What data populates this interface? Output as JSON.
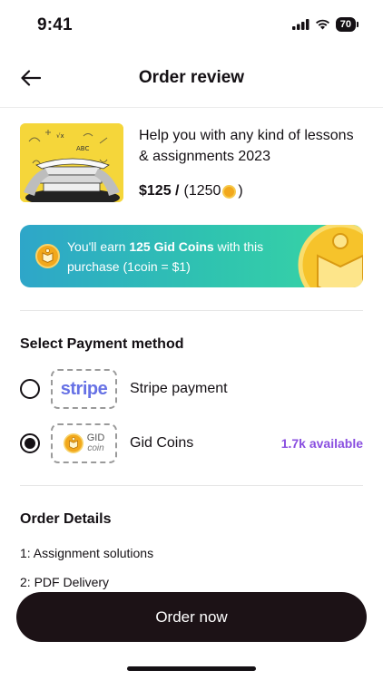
{
  "status_bar": {
    "time": "9:41",
    "battery": "70"
  },
  "header": {
    "title": "Order review",
    "back_icon": "arrow-left-icon"
  },
  "product": {
    "title": "Help you with any kind of lessons & assignments 2023",
    "price": "$125 /",
    "coin_price_open": "(1250",
    "coin_price_close": ")"
  },
  "earn_banner": {
    "prefix": "You'll earn ",
    "highlight": "125 Gid Coins",
    "suffix": " with this purchase (1coin = $1)"
  },
  "payment": {
    "section_title": "Select Payment method",
    "methods": [
      {
        "logo_text": "stripe",
        "label": "Stripe payment",
        "selected": false,
        "available": ""
      },
      {
        "logo_text_1": "GID",
        "logo_text_2": "coin",
        "label": "Gid Coins",
        "selected": true,
        "available": "1.7k available"
      }
    ]
  },
  "order_details": {
    "section_title": "Order Details",
    "lines": [
      "1: Assignment solutions",
      "2: PDF Delivery"
    ]
  },
  "cta": {
    "label": "Order now"
  },
  "colors": {
    "accent_purple": "#8a4fe0",
    "stripe_blue": "#6772e5",
    "button_dark": "#1c1216",
    "banner_start": "#2ea6c9",
    "banner_end": "#38d6a3"
  }
}
